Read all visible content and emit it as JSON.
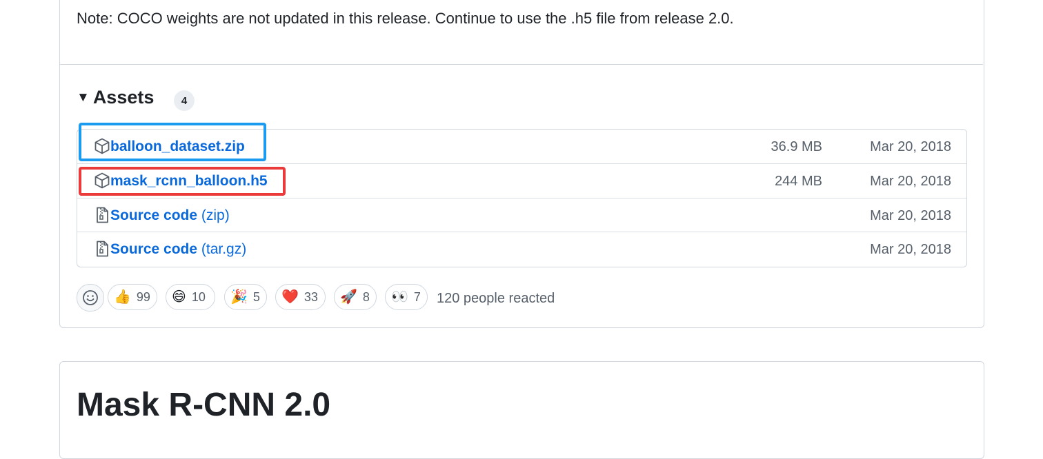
{
  "note": "Note: COCO weights are not updated in this release. Continue to use the .h5 file from release 2.0.",
  "assets": {
    "title": "Assets",
    "count": "4",
    "items": [
      {
        "name": "balloon_dataset.zip",
        "format": "",
        "size": "36.9 MB",
        "date": "Mar 20, 2018",
        "icon": "package-icon"
      },
      {
        "name": "mask_rcnn_balloon.h5",
        "format": "",
        "size": "244 MB",
        "date": "Mar 20, 2018",
        "icon": "package-icon"
      },
      {
        "name": "Source code",
        "format": " (zip)",
        "size": "",
        "date": "Mar 20, 2018",
        "icon": "file-zip-icon"
      },
      {
        "name": "Source code",
        "format": " (tar.gz)",
        "size": "",
        "date": "Mar 20, 2018",
        "icon": "file-zip-icon"
      }
    ]
  },
  "reactions": {
    "items": [
      {
        "emoji": "👍",
        "count": "99",
        "name": "thumbs-up"
      },
      {
        "emoji": "😄",
        "count": "10",
        "name": "laugh"
      },
      {
        "emoji": "🎉",
        "count": "5",
        "name": "hooray"
      },
      {
        "emoji": "❤️",
        "count": "33",
        "name": "heart"
      },
      {
        "emoji": "🚀",
        "count": "8",
        "name": "rocket"
      },
      {
        "emoji": "👀",
        "count": "7",
        "name": "eyes"
      }
    ],
    "summary": "120 people reacted"
  },
  "next_release": {
    "title": "Mask R-CNN 2.0"
  },
  "colors": {
    "link": "#0969da",
    "highlight_blue": "#1a9bf0",
    "highlight_red": "#ea3a3a"
  }
}
